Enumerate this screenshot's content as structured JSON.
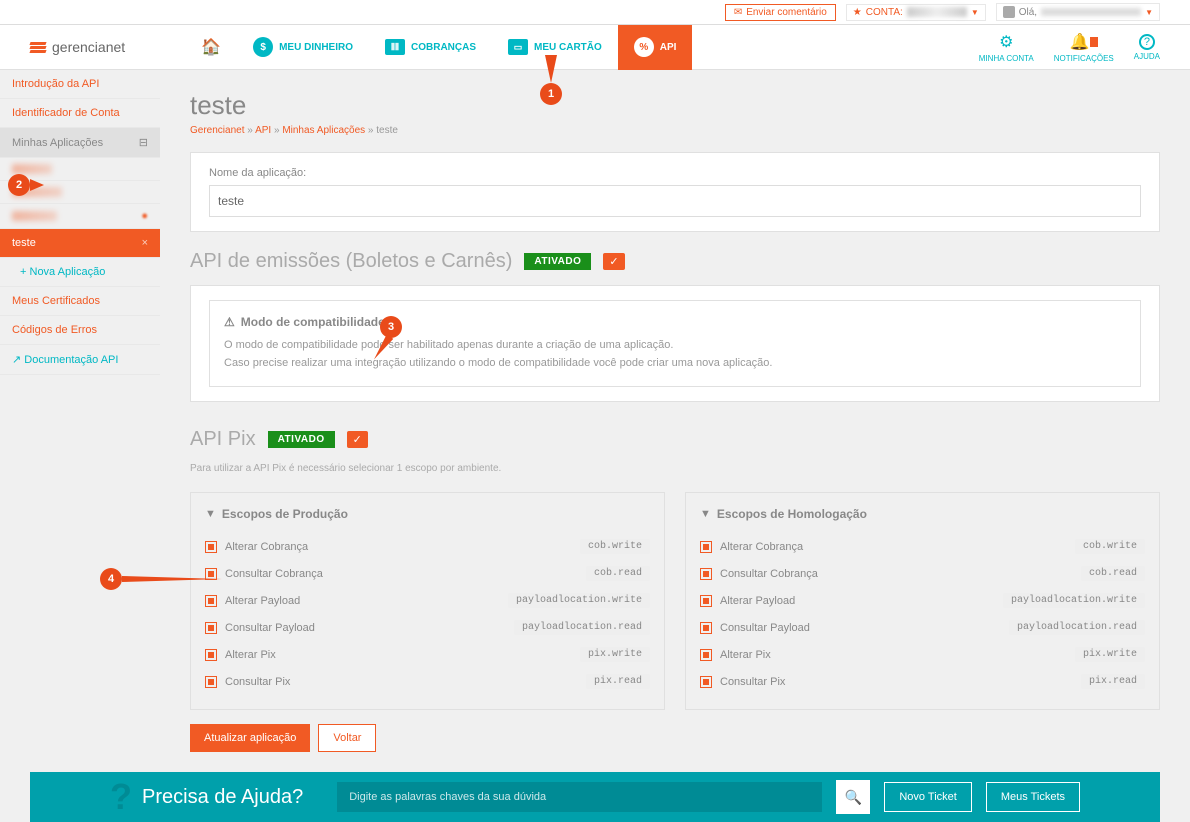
{
  "topbar": {
    "feedback": "Enviar comentário",
    "account_label": "CONTA:",
    "greeting": "Olá,"
  },
  "logo": "gerencianet",
  "nav": {
    "meu_dinheiro": "MEU DINHEIRO",
    "cobrancas": "COBRANÇAS",
    "meu_cartao": "MEU CARTÃO",
    "api": "API"
  },
  "nav_right": {
    "minha_conta": "MINHA CONTA",
    "notificacoes": "NOTIFICAÇÕES",
    "ajuda": "AJUDA"
  },
  "sidebar": {
    "intro": "Introdução da API",
    "identificador": "Identificador de Conta",
    "minhas_apps": "Minhas Aplicações",
    "teste": "teste",
    "nova_app": "Nova Aplicação",
    "certificados": "Meus Certificados",
    "codigos_erros": "Códigos de Erros",
    "documentacao": "Documentação API"
  },
  "page": {
    "title": "teste",
    "breadcrumb_root": "Gerencianet",
    "breadcrumb_api": "API",
    "breadcrumb_apps": "Minhas Aplicações",
    "breadcrumb_current": "teste"
  },
  "form": {
    "name_label": "Nome da aplicação:",
    "name_value": "teste"
  },
  "sections": {
    "emissoes_title": "API de emissões (Boletos e Carnês)",
    "ativado": "ATIVADO",
    "compat_title": "Modo de compatibilidade",
    "compat_line1": "O modo de compatibilidade pode ser habilitado apenas durante a criação de uma aplicação.",
    "compat_line2": "Caso precise realizar uma integração utilizando o modo de compatibilidade você pode criar uma nova aplicação.",
    "pix_title": "API Pix",
    "pix_note": "Para utilizar a API Pix é necessário selecionar 1 escopo por ambiente."
  },
  "scopes": {
    "prod_title": "Escopos de Produção",
    "homolog_title": "Escopos de Homologação",
    "items": [
      {
        "label": "Alterar Cobrança",
        "code": "cob.write"
      },
      {
        "label": "Consultar Cobrança",
        "code": "cob.read"
      },
      {
        "label": "Alterar Payload",
        "code": "payloadlocation.write"
      },
      {
        "label": "Consultar Payload",
        "code": "payloadlocation.read"
      },
      {
        "label": "Alterar Pix",
        "code": "pix.write"
      },
      {
        "label": "Consultar Pix",
        "code": "pix.read"
      }
    ]
  },
  "actions": {
    "update": "Atualizar aplicação",
    "back": "Voltar"
  },
  "help": {
    "title": "Precisa de Ajuda?",
    "placeholder": "Digite as palavras chaves da sua dúvida",
    "novo_ticket": "Novo Ticket",
    "meus_tickets": "Meus Tickets"
  },
  "callouts": {
    "c1": "1",
    "c2": "2",
    "c3": "3",
    "c4": "4"
  }
}
